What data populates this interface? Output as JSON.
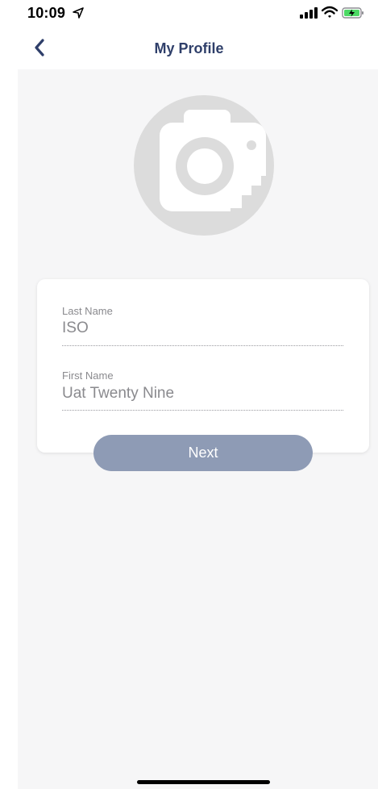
{
  "status_bar": {
    "time": "10:09",
    "icons": [
      "location-arrow-icon",
      "cellular-signal-icon",
      "wifi-icon",
      "battery-charging-icon"
    ],
    "battery_color": "#4cd964"
  },
  "nav": {
    "back_icon": "chevron-left-icon",
    "title": "My Profile",
    "title_color": "#2f3f6a"
  },
  "profile": {
    "avatar_icon": "camera-icon"
  },
  "form": {
    "last_name": {
      "label": "Last Name",
      "value": "ISO"
    },
    "first_name": {
      "label": "First Name",
      "value": "Uat Twenty Nine"
    }
  },
  "actions": {
    "next_label": "Next",
    "next_color": "#8e9bb5"
  }
}
